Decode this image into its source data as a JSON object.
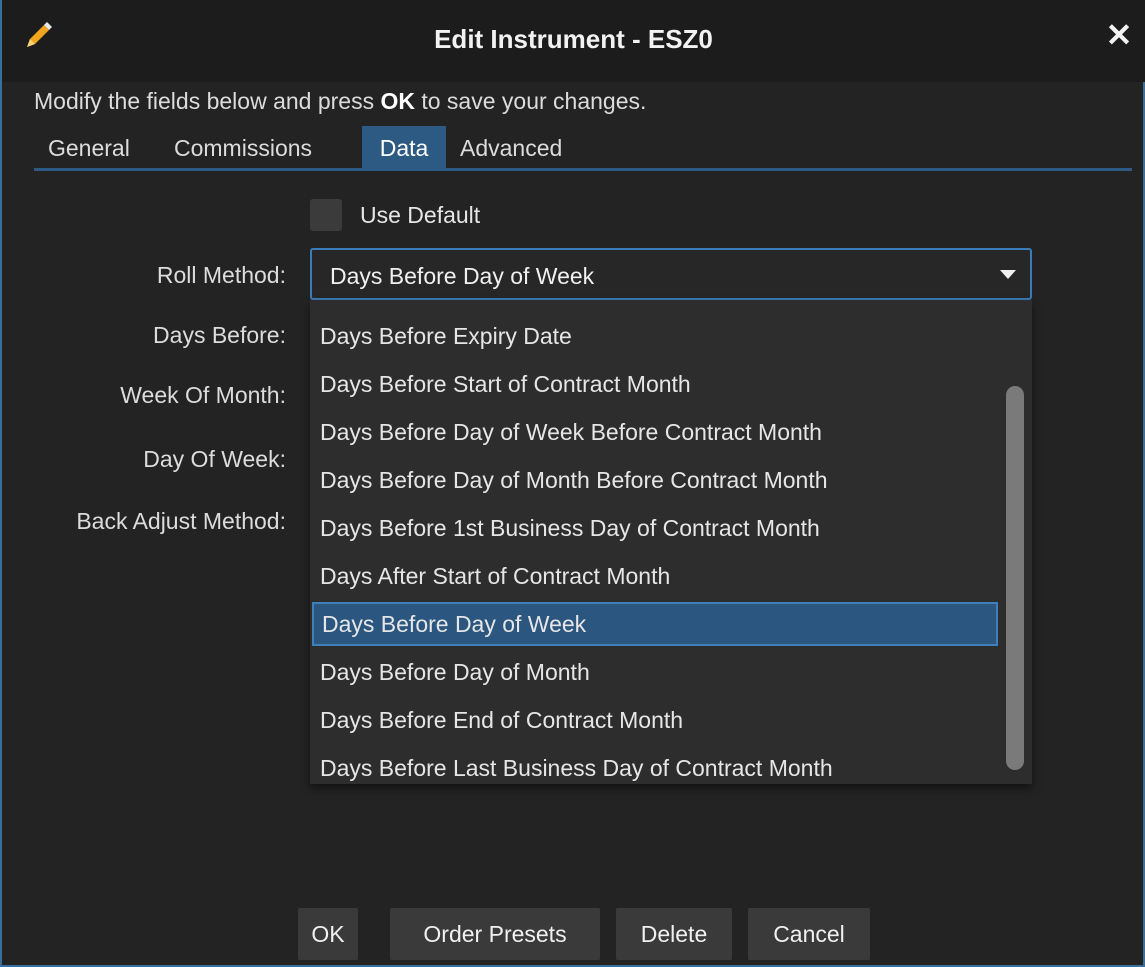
{
  "window": {
    "title": "Edit Instrument - ESZ0"
  },
  "instructions": {
    "prefix": "Modify the fields below and press ",
    "bold": "OK",
    "suffix": " to save your changes."
  },
  "tabs": [
    {
      "label": "General"
    },
    {
      "label": "Commissions"
    },
    {
      "label": "Data",
      "active": true
    },
    {
      "label": "Advanced"
    }
  ],
  "form": {
    "use_default_label": "Use Default",
    "use_default_checked": false,
    "labels": {
      "roll_method": "Roll Method:",
      "days_before": "Days Before:",
      "week_of_month": "Week Of Month:",
      "day_of_week": "Day Of Week:",
      "back_adjust_method": "Back Adjust Method:"
    },
    "roll_method_value": "Days Before Day of Week"
  },
  "dropdown": {
    "options": [
      "Days Before Expiry Date",
      "Days Before Start of Contract Month",
      "Days Before Day of Week Before Contract Month",
      "Days Before Day of Month Before Contract Month",
      "Days Before 1st Business Day of Contract Month",
      "Days After Start of Contract Month",
      "Days Before Day of Week",
      "Days Before Day of Month",
      "Days Before End of Contract Month",
      "Days Before Last Business Day of Contract Month"
    ],
    "selected_index": 6
  },
  "buttons": {
    "ok": "OK",
    "order_presets": "Order Presets",
    "delete": "Delete",
    "cancel": "Cancel"
  },
  "colors": {
    "accent": "#2d5a82",
    "focus_border": "#3a7cb8",
    "background": "#232323"
  }
}
